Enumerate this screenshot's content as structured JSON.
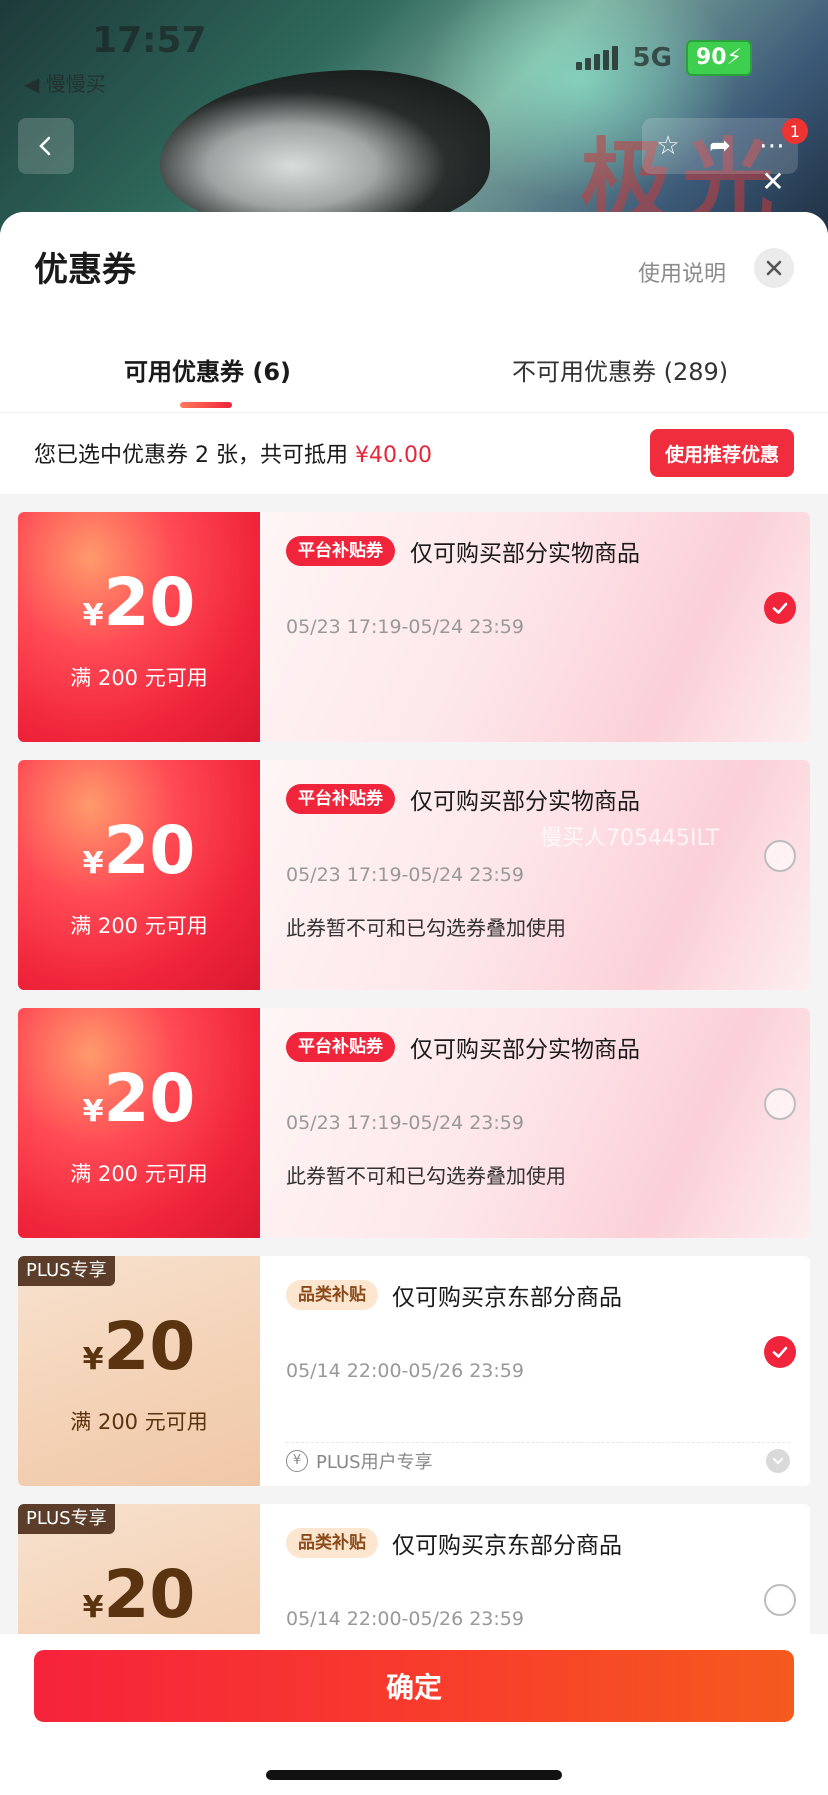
{
  "status_bar": {
    "time": "17:57",
    "back_app": "◀ 慢慢买",
    "network": "5G",
    "battery": "90"
  },
  "background": {
    "banner_text": "极光",
    "notification_count": "1"
  },
  "sheet": {
    "title": "优惠券",
    "usage_link": "使用说明",
    "tabs": [
      {
        "label": "可用优惠券 (6)",
        "active": true
      },
      {
        "label": "不可用优惠券 (289)",
        "active": false
      }
    ],
    "summary": {
      "prefix": "您已选中优惠券 2 张，共可抵用 ",
      "amount": "¥40.00"
    },
    "recommend_button": "使用推荐优惠",
    "watermark": "慢买人705445ILT",
    "coupons": [
      {
        "style": "platform",
        "currency": "¥",
        "amount": "20",
        "threshold": "满 200 元可用",
        "tag": "平台补贴券",
        "description": "仅可购买部分实物商品",
        "validity": "05/23 17:19-05/24 23:59",
        "note": "",
        "selected": true
      },
      {
        "style": "platform",
        "currency": "¥",
        "amount": "20",
        "threshold": "满 200 元可用",
        "tag": "平台补贴券",
        "description": "仅可购买部分实物商品",
        "validity": "05/23 17:19-05/24 23:59",
        "note": "此券暂不可和已勾选券叠加使用",
        "selected": false
      },
      {
        "style": "platform",
        "currency": "¥",
        "amount": "20",
        "threshold": "满 200 元可用",
        "tag": "平台补贴券",
        "description": "仅可购买部分实物商品",
        "validity": "05/23 17:19-05/24 23:59",
        "note": "此券暂不可和已勾选券叠加使用",
        "selected": false
      },
      {
        "style": "plus",
        "plus_badge": "PLUS专享",
        "currency": "¥",
        "amount": "20",
        "threshold": "满 200 元可用",
        "tag": "品类补贴",
        "description": "仅可购买京东部分商品",
        "validity": "05/14 22:00-05/26 23:59",
        "footer": "PLUS用户专享",
        "selected": true
      },
      {
        "style": "plus",
        "plus_badge": "PLUS专享",
        "currency": "¥",
        "amount": "20",
        "threshold": "",
        "tag": "品类补贴",
        "description": "仅可购买京东部分商品",
        "validity": "05/14 22:00-05/26 23:59",
        "footer": "",
        "selected": false
      }
    ],
    "confirm_button": "确定"
  },
  "colors": {
    "accent": "#f0243a",
    "amount": "#e8263a",
    "plus_brown": "#5b3d2a"
  }
}
